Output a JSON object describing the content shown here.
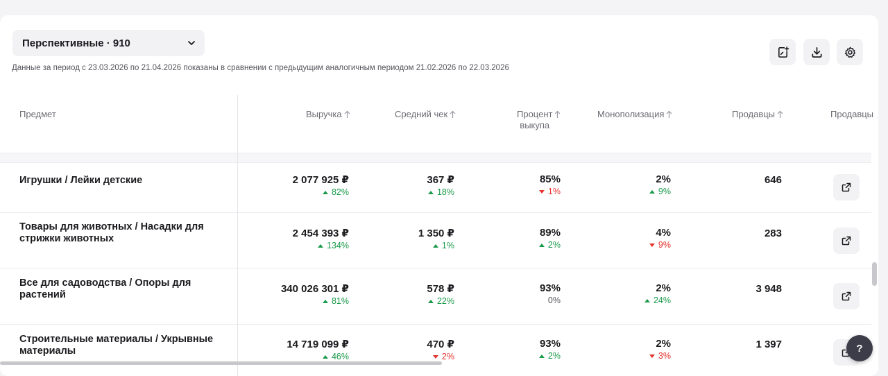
{
  "filter": {
    "selected": "Перспективные · 910"
  },
  "period_text": "Данные за период с 23.03.2026 по 21.04.2026 показаны в сравнении с предыдущим аналогичным периодом 21.02.2026 по 22.03.2026",
  "toolbar": {
    "add_icon": "note-add-icon",
    "download_icon": "download-icon",
    "settings_icon": "gear-icon"
  },
  "columns": {
    "subject": "Предмет",
    "revenue": "Выручка",
    "avg_check": "Средний чек",
    "buyout_1": "Процент",
    "buyout_2": "выкупа",
    "monopoly": "Монополизация",
    "sellers": "Продавцы",
    "sellers2": "Продавцы"
  },
  "rows": [
    {
      "name": "Игрушки / Лейки детские",
      "revenue": "2 077 925 ₽",
      "revenue_delta": "82%",
      "revenue_dir": "up",
      "avg": "367 ₽",
      "avg_delta": "18%",
      "avg_dir": "up",
      "buyout": "85%",
      "buyout_delta": "1%",
      "buyout_dir": "down",
      "monopoly": "2%",
      "monopoly_delta": "9%",
      "monopoly_dir": "up",
      "sellers": "646"
    },
    {
      "name": "Товары для животных / Насадки для стрижки животных",
      "revenue": "2 454 393 ₽",
      "revenue_delta": "134%",
      "revenue_dir": "up",
      "avg": "1 350 ₽",
      "avg_delta": "1%",
      "avg_dir": "up",
      "buyout": "89%",
      "buyout_delta": "2%",
      "buyout_dir": "up",
      "monopoly": "4%",
      "monopoly_delta": "9%",
      "monopoly_dir": "down",
      "sellers": "283"
    },
    {
      "name": "Все для садоводства / Опоры для растений",
      "revenue": "340 026 301 ₽",
      "revenue_delta": "81%",
      "revenue_dir": "up",
      "avg": "578 ₽",
      "avg_delta": "22%",
      "avg_dir": "up",
      "buyout": "93%",
      "buyout_delta": "0%",
      "buyout_dir": "flat",
      "monopoly": "2%",
      "monopoly_delta": "24%",
      "monopoly_dir": "up",
      "sellers": "3 948"
    },
    {
      "name": "Строительные материалы / Укрывные материалы",
      "revenue": "14 719 099 ₽",
      "revenue_delta": "46%",
      "revenue_dir": "up",
      "avg": "470 ₽",
      "avg_delta": "2%",
      "avg_dir": "down",
      "buyout": "93%",
      "buyout_delta": "2%",
      "buyout_dir": "up",
      "monopoly": "2%",
      "monopoly_delta": "3%",
      "monopoly_dir": "down",
      "sellers": "1 397"
    }
  ],
  "help": "?"
}
